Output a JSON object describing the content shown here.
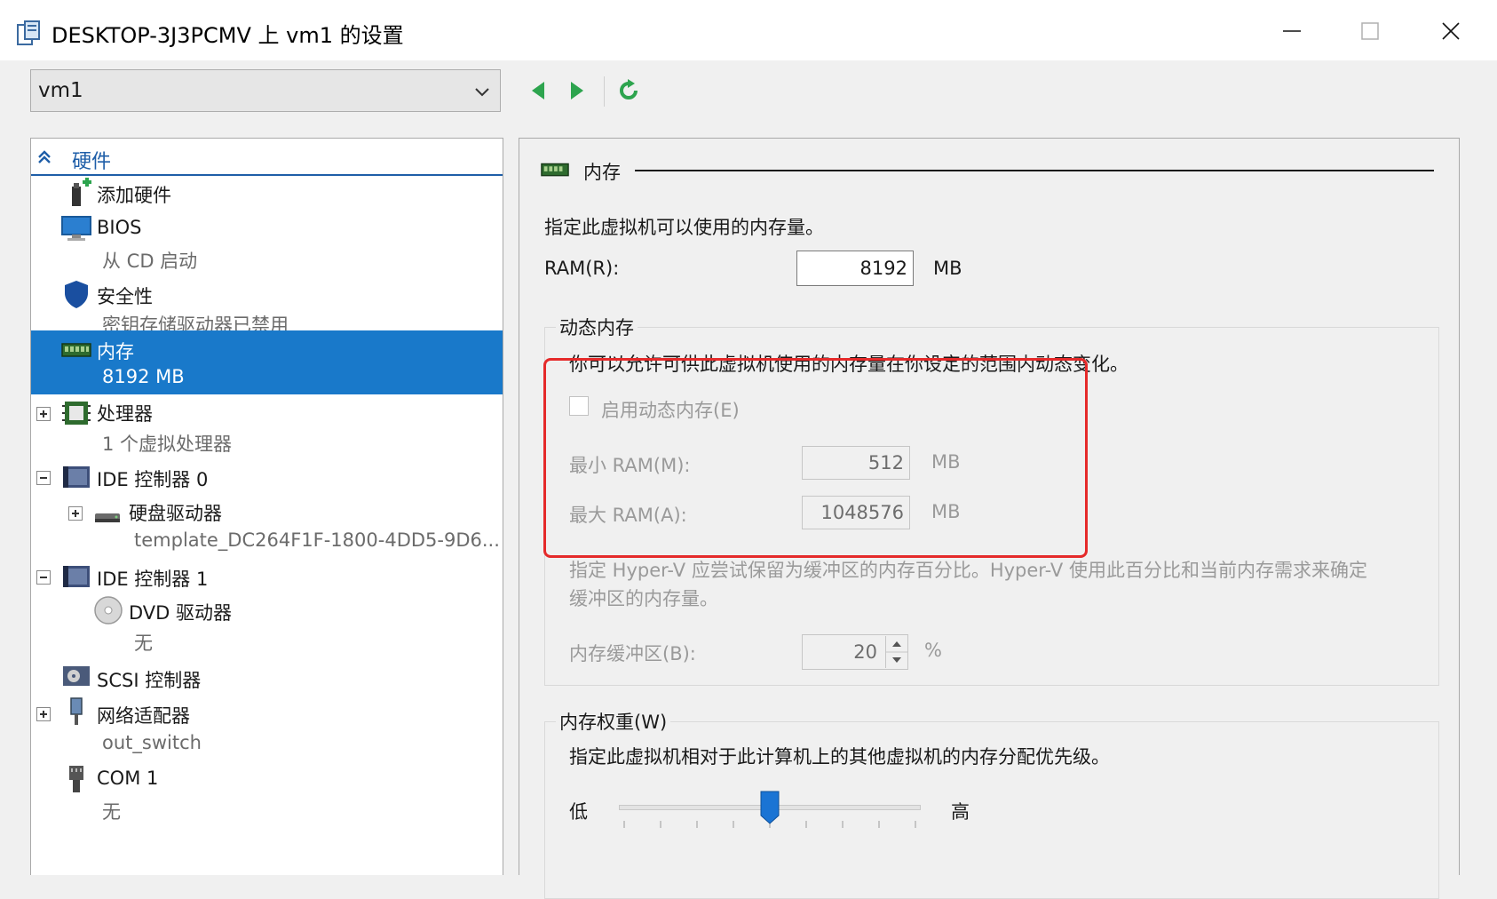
{
  "window": {
    "title": "DESKTOP-3J3PCMV 上 vm1 的设置",
    "minimize_icon": "minimize-icon",
    "maximize_icon": "maximize-icon",
    "close_icon": "close-icon"
  },
  "toolbar": {
    "vm_select_value": "vm1",
    "back_icon": "back-arrow-icon",
    "forward_icon": "forward-arrow-icon",
    "refresh_icon": "refresh-icon"
  },
  "tree": {
    "header": "硬件",
    "items": [
      {
        "label": "添加硬件",
        "sub": "",
        "icon": "add-hardware-icon"
      },
      {
        "label": "BIOS",
        "sub": "从 CD 启动",
        "icon": "monitor-icon"
      },
      {
        "label": "安全性",
        "sub": "密钥存储驱动器已禁用",
        "icon": "shield-icon"
      },
      {
        "label": "内存",
        "sub": "8192 MB",
        "icon": "memory-icon"
      },
      {
        "label": "处理器",
        "sub": "1 个虚拟处理器",
        "icon": "processor-icon"
      },
      {
        "label": "IDE 控制器 0",
        "sub": "",
        "icon": "ide-controller-icon"
      },
      {
        "label": "硬盘驱动器",
        "sub": "template_DC264F1F-1800-4DD5-9D6...",
        "icon": "hard-drive-icon"
      },
      {
        "label": "IDE 控制器 1",
        "sub": "",
        "icon": "ide-controller-icon"
      },
      {
        "label": "DVD 驱动器",
        "sub": "无",
        "icon": "dvd-icon"
      },
      {
        "label": "SCSI 控制器",
        "sub": "",
        "icon": "scsi-controller-icon"
      },
      {
        "label": "网络适配器",
        "sub": "out_switch",
        "icon": "network-adapter-icon"
      },
      {
        "label": "COM 1",
        "sub": "无",
        "icon": "com-port-icon"
      }
    ]
  },
  "memory": {
    "section_title": "内存",
    "description": "指定此虚拟机可以使用的内存量。",
    "ram_label": "RAM(R):",
    "ram_value": "8192",
    "ram_unit": "MB",
    "dynamic": {
      "caption": "动态内存",
      "description": "你可以允许可供此虚拟机使用的内存量在你设定的范围内动态变化。",
      "enable_label": "启用动态内存(E)",
      "enable_checked": false,
      "min_label": "最小 RAM(M):",
      "min_value": "512",
      "min_unit": "MB",
      "max_label": "最大 RAM(A):",
      "max_value": "1048576",
      "max_unit": "MB",
      "buffer_desc_1": "指定 Hyper-V 应尝试保留为缓冲区的内存百分比。Hyper-V 使用此百分比和当前内存需求来确定",
      "buffer_desc_2": "缓冲区的内存量。",
      "buffer_label": "内存缓冲区(B):",
      "buffer_value": "20",
      "buffer_unit": "%"
    },
    "weight": {
      "caption": "内存权重(W)",
      "description": "指定此虚拟机相对于此计算机上的其他虚拟机的内存分配优先级。",
      "low_label": "低",
      "high_label": "高",
      "slider_fraction": 0.5
    }
  },
  "colors": {
    "selection": "#1979ca",
    "highlight_box": "#e52a2a",
    "accent_green": "#2da44e"
  }
}
